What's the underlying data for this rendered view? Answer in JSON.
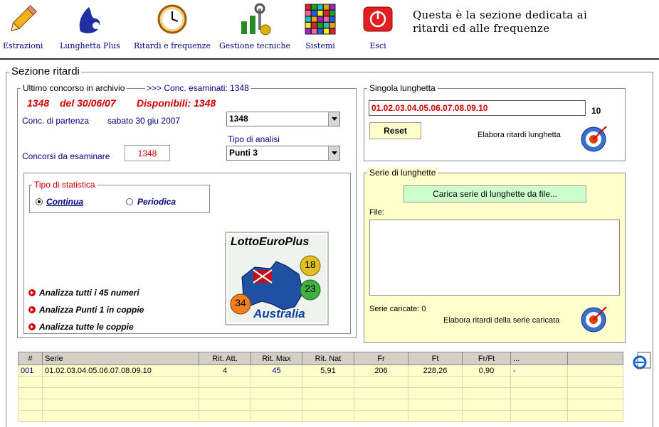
{
  "toolbar": {
    "items": [
      {
        "label": "Estrazioni",
        "icon": "pencil-icon"
      },
      {
        "label": "Lunghetta Plus",
        "icon": "lottery-hand-icon"
      },
      {
        "label": "Ritardi e frequenze",
        "icon": "clock-icon"
      },
      {
        "label": "Gestione tecniche",
        "icon": "tools-icon"
      },
      {
        "label": "Sistemi",
        "icon": "grid-icon"
      },
      {
        "label": "Esci",
        "icon": "exit-icon"
      }
    ],
    "header_line1": "Questa è la sezione dedicata ai",
    "header_line2": "ritardi ed alle frequenze"
  },
  "section": {
    "title": "Sezione ritardi",
    "archive_legend": "Ultimo concorso in archivio",
    "conc_examined": ">>> Conc. esaminati: 1348",
    "last_conc_num": "1348",
    "last_conc_date": "del 30/06/07",
    "available": "Disponibili: 1348",
    "start_label": "Conc. di partenza",
    "start_date": "sabato 30 giu 2007",
    "start_value": "1348",
    "analysis_label": "Tipo di analisi",
    "analysis_value": "Punti 3",
    "to_examine_label": "Concorsi da esaminare",
    "to_examine_value": "1348",
    "stat_legend": "Tipo di statistica",
    "stat_continua": "Continua",
    "stat_periodica": "Periodica",
    "logo_title": "LottoEuroPlus",
    "logo_sub": "Australia",
    "logo_balls": [
      "18",
      "23",
      "34"
    ],
    "links": [
      "Analizza tutti i 45 numeri",
      "Analizza Punti 1 in coppie",
      "Analizza tutte le coppie"
    ]
  },
  "single": {
    "legend": "Singola lunghetta",
    "value": "01.02.03.04.05.06.07.08.09.10",
    "count": "10",
    "reset": "Reset",
    "process": "Elabora ritardi lunghetta"
  },
  "series": {
    "legend": "Serie di lunghette",
    "load_button": "Carica serie di lunghette da file...",
    "file_label": "File:",
    "loaded": "Serie caricate: 0",
    "process": "Elabora ritardi della serie caricata"
  },
  "table": {
    "headers": [
      "#",
      "Serie",
      "Rit. Att.",
      "Rit. Max",
      "Rit. Nat",
      "Fr",
      "Ft",
      "Fr/Ft",
      "..."
    ],
    "rows": [
      [
        "001",
        "01.02.03.04.05.06.07.08.09.10",
        "4",
        "45",
        "5,91",
        "206",
        "228,26",
        "0,90",
        "-"
      ]
    ]
  },
  "colors": {
    "red": "#d00000",
    "navy": "#000080",
    "yellow": "#ffffcc"
  }
}
